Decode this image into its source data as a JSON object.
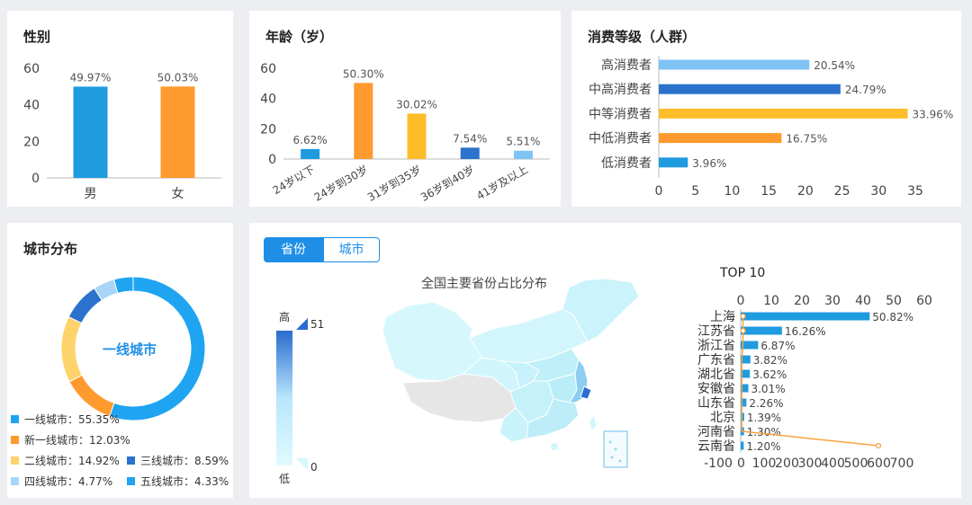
{
  "gender": {
    "title": "性别",
    "chart_data": {
      "type": "bar",
      "categories": [
        "男",
        "女"
      ],
      "values": [
        49.97,
        50.03
      ],
      "value_labels": [
        "49.97%",
        "50.03%"
      ],
      "colors": [
        "#1f9be0",
        "#ff9a2e"
      ],
      "ylim": [
        0,
        60
      ],
      "yticks": [
        0,
        20,
        40,
        60
      ]
    }
  },
  "age": {
    "title": "年龄（岁）",
    "chart_data": {
      "type": "bar",
      "categories": [
        "24岁以下",
        "24岁到30岁",
        "31岁到35岁",
        "36岁到40岁",
        "41岁及以上"
      ],
      "values": [
        6.62,
        50.3,
        30.02,
        7.54,
        5.51
      ],
      "value_labels": [
        "6.62%",
        "50.30%",
        "30.02%",
        "7.54%",
        "5.51%"
      ],
      "colors": [
        "#1f9be0",
        "#ff9a2e",
        "#fdbd2a",
        "#2a72cc",
        "#7fc3f5"
      ],
      "ylim": [
        0,
        60
      ],
      "yticks": [
        0,
        20,
        40,
        60
      ]
    }
  },
  "consume": {
    "title": "消费等级（人群）",
    "chart_data": {
      "type": "bar",
      "orientation": "horizontal",
      "categories": [
        "高消费者",
        "中高消费者",
        "中等消费者",
        "中低消费者",
        "低消费者"
      ],
      "values": [
        20.54,
        24.79,
        33.96,
        16.75,
        3.96
      ],
      "value_labels": [
        "20.54%",
        "24.79%",
        "33.96%",
        "16.75%",
        "3.96%"
      ],
      "colors": [
        "#7fc3f5",
        "#2a72cc",
        "#fdbd2a",
        "#ff9a2e",
        "#1f9be0"
      ],
      "xlim": [
        0,
        35
      ],
      "xticks": [
        0,
        5,
        10,
        15,
        20,
        25,
        30,
        35
      ]
    }
  },
  "city": {
    "title": "城市分布",
    "center_label": "一线城市",
    "chart_data": {
      "type": "pie",
      "categories": [
        "一线城市",
        "新一线城市",
        "二线城市",
        "三线城市",
        "四线城市",
        "五线城市"
      ],
      "values": [
        55.35,
        12.03,
        14.92,
        8.59,
        4.77,
        4.33
      ],
      "legend_labels": [
        "一线城市：55.35%",
        "新一线城市：12.03%",
        "二线城市：14.92%",
        "三线城市：8.59%",
        "四线城市：4.77%",
        "五线城市：4.33%"
      ],
      "colors": [
        "#1fa4f2",
        "#ff9a2e",
        "#fdd36b",
        "#2a72cc",
        "#a8d4f8",
        "#1fa4f2"
      ]
    }
  },
  "region": {
    "tabs": [
      "省份",
      "城市"
    ],
    "active_tab": "省份",
    "map_title": "全国主要省份占比分布",
    "visual_map": {
      "max_label": "高",
      "min_label": "低",
      "max_value": "51",
      "min_value": "0"
    },
    "top_title": "TOP 10",
    "chart_data": {
      "type": "bar",
      "orientation": "horizontal",
      "categories": [
        "上海",
        "江苏省",
        "浙江省",
        "广东省",
        "湖北省",
        "安徽省",
        "山东省",
        "北京",
        "河南省",
        "云南省"
      ],
      "values": [
        50.82,
        16.26,
        6.87,
        3.82,
        3.62,
        3.01,
        2.26,
        1.39,
        1.3,
        1.2
      ],
      "value_labels": [
        "50.82%",
        "16.26%",
        "6.87%",
        "3.82%",
        "3.62%",
        "3.01%",
        "2.26%",
        "1.39%",
        "1.30%",
        "1.20%"
      ],
      "top_ticks": [
        "0",
        "10",
        "20",
        "30",
        "40",
        "50",
        "60"
      ],
      "bottom_ticks": [
        "-100",
        "0",
        "100",
        "200",
        "300",
        "400",
        "500",
        "600",
        "700"
      ],
      "bar_color": "#1f9be0",
      "line_color": "#f7a23c"
    }
  }
}
